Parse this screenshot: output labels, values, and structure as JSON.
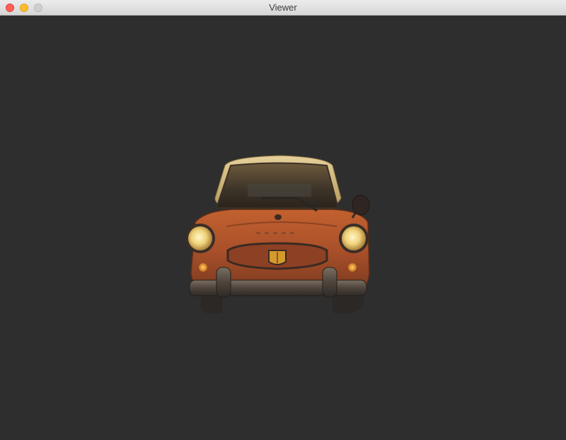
{
  "window": {
    "title": "Viewer"
  },
  "scene": {
    "object": "rusty-vintage-car-front-view",
    "background_color": "#2e2e2e",
    "body_color": "#b4552a",
    "roof_color": "#d9bf83"
  }
}
